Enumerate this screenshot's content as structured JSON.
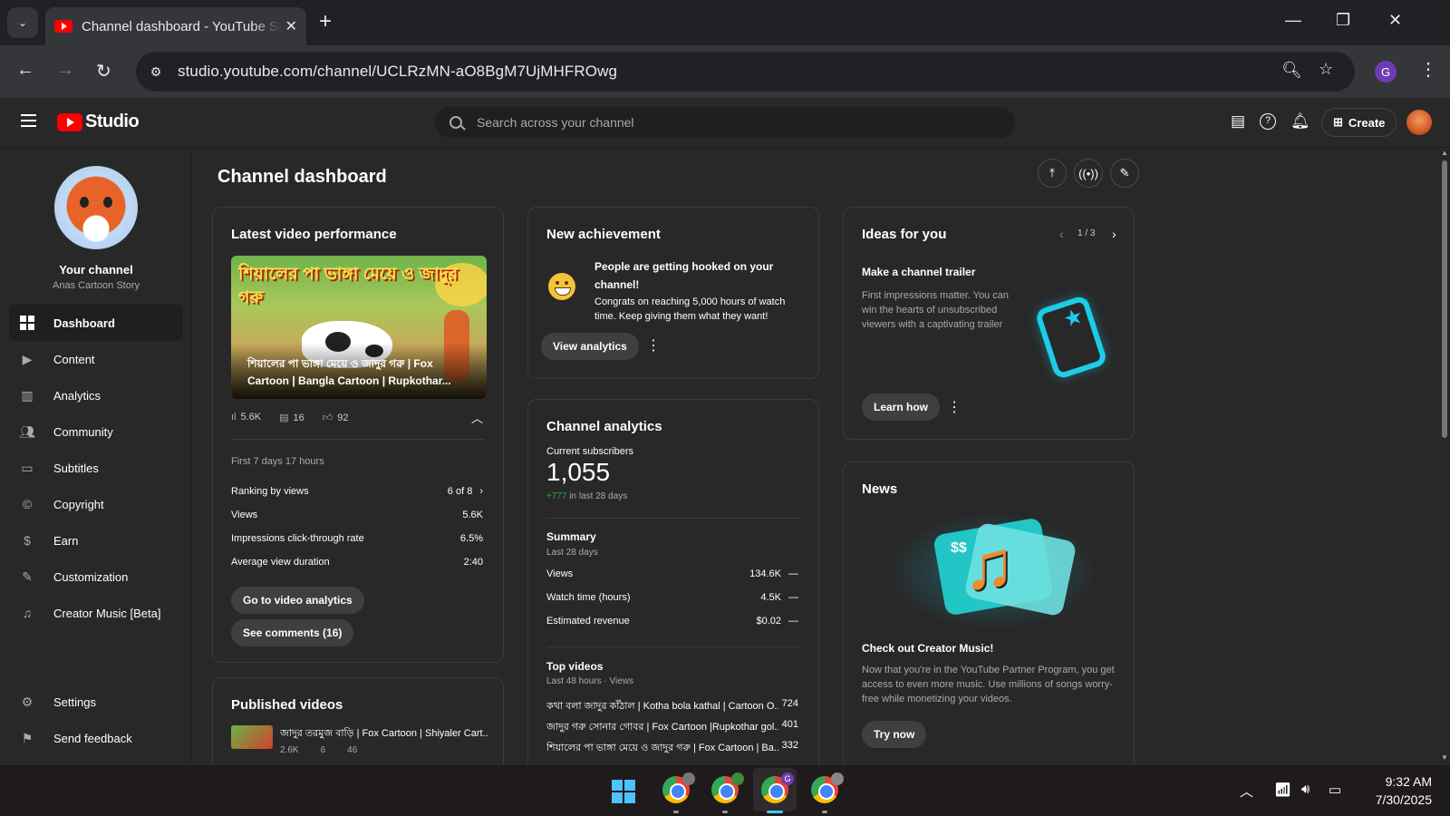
{
  "browser": {
    "tab_title": "Channel dashboard - YouTube Studio",
    "url": "studio.youtube.com/channel/UCLRzMN-aO8BgM7UjMHFROwg",
    "profile_initial": "G"
  },
  "header": {
    "logo_text": "Studio",
    "search_placeholder": "Search across your channel",
    "create_label": "Create"
  },
  "sidebar": {
    "your_channel": "Your channel",
    "channel_name": "Anas Cartoon Story",
    "items": [
      {
        "label": "Dashboard",
        "icon": "dashboard-icon",
        "active": true
      },
      {
        "label": "Content",
        "icon": "content-icon"
      },
      {
        "label": "Analytics",
        "icon": "analytics-icon"
      },
      {
        "label": "Community",
        "icon": "community-icon"
      },
      {
        "label": "Subtitles",
        "icon": "subtitles-icon"
      },
      {
        "label": "Copyright",
        "icon": "copyright-icon"
      },
      {
        "label": "Earn",
        "icon": "earn-icon"
      },
      {
        "label": "Customization",
        "icon": "customization-icon"
      },
      {
        "label": "Creator Music [Beta]",
        "icon": "creator-music-icon"
      }
    ],
    "settings": "Settings",
    "feedback": "Send feedback"
  },
  "main": {
    "title": "Channel dashboard",
    "latest": {
      "title": "Latest video performance",
      "thumb_text": "শিয়ালের পা ভাঙ্গা মেয়ে ও জাদুর গরু",
      "video_title": "শিয়ালের পা ভাঙ্গা মেয়ে ও জাদুর গরু | Fox Cartoon | Bangla Cartoon | Rupkothar...",
      "views": "5.6K",
      "comments": "16",
      "likes": "92",
      "period": "First 7 days 17 hours",
      "ranking_label": "Ranking by views",
      "ranking_value": "6 of 8",
      "views_label": "Views",
      "views_value": "5.6K",
      "ctr_label": "Impressions click-through rate",
      "ctr_value": "6.5%",
      "avd_label": "Average view duration",
      "avd_value": "2:40",
      "btn_analytics": "Go to video analytics",
      "btn_comments": "See comments (16)"
    },
    "published": {
      "title": "Published videos",
      "item_title": "জাদুর তরমুজ বাড়ি | Fox Cartoon | Shiyaler Cart...",
      "item_views": "2.6K",
      "item_comments": "6",
      "item_likes": "46"
    },
    "achievement": {
      "title": "New achievement",
      "headline": "People are getting hooked on your channel!",
      "body": "Congrats on reaching 5,000 hours of watch time. Keep giving them what they want!",
      "button": "View analytics"
    },
    "analytics": {
      "title": "Channel analytics",
      "subs_label": "Current subscribers",
      "subs_value": "1,055",
      "subs_delta": "+777",
      "subs_delta_suffix": " in last 28 days",
      "summary": "Summary",
      "summary_period": "Last 28 days",
      "rows": [
        {
          "label": "Views",
          "value": "134.6K"
        },
        {
          "label": "Watch time (hours)",
          "value": "4.5K"
        },
        {
          "label": "Estimated revenue",
          "value": "$0.02"
        }
      ],
      "top_videos": "Top videos",
      "top_period": "Last 48 hours · Views",
      "top_list": [
        {
          "title": "কথা বলা জাদুর কাঁঠাল | Kotha bola kathal | Cartoon O...",
          "views": "724"
        },
        {
          "title": "জাদুর গরু সোনার গোবর | Fox Cartoon |Rupkothar gol...",
          "views": "401"
        },
        {
          "title": "শিয়ালের পা ভাঙ্গা মেয়ে ও জাদুর গরু | Fox Cartoon | Ba...",
          "views": "332"
        }
      ]
    },
    "ideas": {
      "title": "Ideas for you",
      "pager": "1 / 3",
      "heading": "Make a channel trailer",
      "body": "First impressions matter. You can win the hearts of unsubscribed viewers with a captivating trailer",
      "button": "Learn how"
    },
    "news": {
      "title": "News",
      "heading": "Check out Creator Music!",
      "body": "Now that you're in the YouTube Partner Program, you get access to even more music. Use millions of songs worry-free while monetizing your videos.",
      "button": "Try now"
    }
  },
  "taskbar": {
    "time": "9:32 AM",
    "date": "7/30/2025"
  },
  "colors": {
    "accent_red": "#ff0000",
    "positive_green": "#2ba640",
    "trailer_cyan": "#1ccde8"
  }
}
